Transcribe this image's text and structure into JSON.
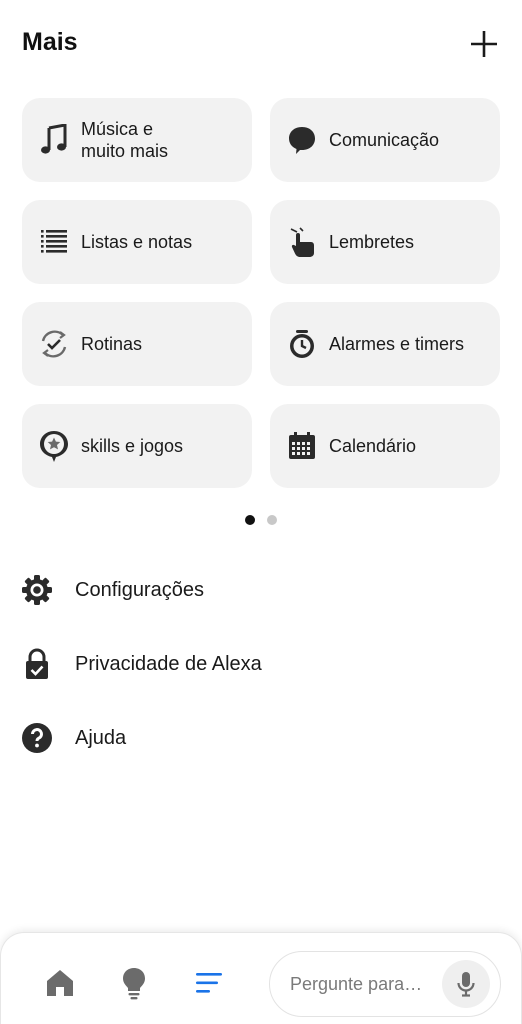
{
  "header": {
    "title": "Mais"
  },
  "tiles": [
    {
      "label_line1": "Música e",
      "label_line2": "muito mais",
      "icon": "music-note-icon"
    },
    {
      "label": "Comunicação",
      "icon": "chat-bubble-icon"
    },
    {
      "label": "Listas e notas",
      "icon": "list-icon"
    },
    {
      "label": "Lembretes",
      "icon": "reminder-hand-icon"
    },
    {
      "label": "Rotinas",
      "icon": "routine-check-icon"
    },
    {
      "label": "Alarmes e timers",
      "icon": "alarm-clock-icon"
    },
    {
      "label": "skills e jogos",
      "icon": "skills-star-icon"
    },
    {
      "label": "Calendário",
      "icon": "calendar-icon"
    }
  ],
  "pagination": {
    "current": 1,
    "total": 2
  },
  "menu": [
    {
      "label": "Configurações",
      "icon": "gear-icon"
    },
    {
      "label": "Privacidade de Alexa",
      "icon": "lock-check-icon"
    },
    {
      "label": "Ajuda",
      "icon": "help-icon"
    }
  ],
  "bottom_nav": {
    "items": [
      "home-icon",
      "devices-bulb-icon",
      "more-menu-icon"
    ],
    "active": "more-menu-icon",
    "ask_placeholder": "Pergunte para…"
  },
  "colors": {
    "accent": "#1a73e8",
    "icon_dark": "#2b2b2b",
    "tile_bg": "#f2f2f2"
  }
}
